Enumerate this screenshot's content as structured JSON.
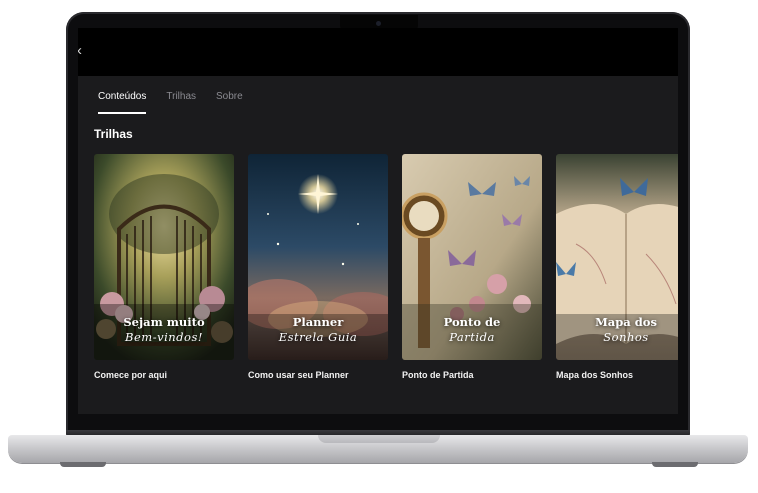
{
  "tabs": [
    {
      "label": "Conteúdos",
      "active": true
    },
    {
      "label": "Trilhas",
      "active": false
    },
    {
      "label": "Sobre",
      "active": false
    }
  ],
  "section": {
    "title": "Trilhas"
  },
  "cards": [
    {
      "cover_line1": "Sejam muito",
      "cover_line2": "Bem-vindos!",
      "label": "Comece por aqui",
      "theme": "garden-gate"
    },
    {
      "cover_line1": "Planner",
      "cover_line2": "Estrela Guia",
      "label": "Como usar seu Planner",
      "theme": "starry-night"
    },
    {
      "cover_line1": "Ponto de",
      "cover_line2": "Partida",
      "label": "Ponto de Partida",
      "theme": "clock-butterflies"
    },
    {
      "cover_line1": "Mapa dos",
      "cover_line2": "Sonhos",
      "label": "Mapa dos Sonhos",
      "theme": "map-butterflies"
    }
  ],
  "icons": {
    "back": "chevron-left-icon"
  },
  "colors": {
    "app_bg": "#1b1b1d",
    "text": "#ffffff",
    "muted": "#8a8a90"
  }
}
